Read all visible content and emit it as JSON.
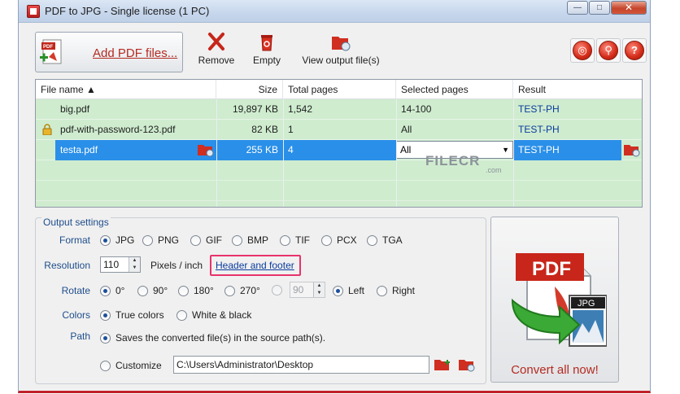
{
  "window": {
    "title": "PDF to JPG - Single license (1 PC)"
  },
  "toolbar": {
    "add_label": "Add PDF files...",
    "remove_label": "Remove",
    "empty_label": "Empty",
    "view_output_label": "View output file(s)",
    "help_label": "?"
  },
  "grid": {
    "headers": {
      "file_name": "File name ▲",
      "size": "Size",
      "total_pages": "Total pages",
      "selected_pages": "Selected pages",
      "result": "Result"
    },
    "rows": [
      {
        "file_name": "big.pdf",
        "size": "19,897 KB",
        "total_pages": "1,542",
        "selected_pages": "14-100",
        "result": "TEST-PH",
        "locked": false
      },
      {
        "file_name": "pdf-with-password-123.pdf",
        "size": "82 KB",
        "total_pages": "1",
        "selected_pages": "All",
        "result": "TEST-PH",
        "locked": true
      },
      {
        "file_name": "testa.pdf",
        "size": "255 KB",
        "total_pages": "4",
        "selected_pages": "All",
        "result": "TEST-PH",
        "locked": false,
        "selected": true
      }
    ]
  },
  "watermark": {
    "text": "FILECR",
    "sub": ".com"
  },
  "output": {
    "title": "Output settings",
    "format_label": "Format",
    "formats": [
      "JPG",
      "PNG",
      "GIF",
      "BMP",
      "TIF",
      "PCX",
      "TGA"
    ],
    "format_selected": "JPG",
    "resolution_label": "Resolution",
    "resolution_value": "110",
    "resolution_unit": "Pixels / inch",
    "header_footer_link": "Header and footer",
    "rotate_label": "Rotate",
    "rotations": [
      "0°",
      "90°",
      "180°",
      "270°"
    ],
    "rotation_selected": "0°",
    "custom_angle_value": "90",
    "rotate_left": "Left",
    "rotate_right": "Right",
    "colors_label": "Colors",
    "colors": [
      "True colors",
      "White & black"
    ],
    "colors_selected": "True colors",
    "path_label": "Path",
    "path_source_option": "Saves the converted file(s) in the source path(s).",
    "path_customize_option": "Customize",
    "path_value": "C:\\Users\\Administrator\\Desktop"
  },
  "convert": {
    "label": "Convert all now!",
    "pdf_text": "PDF",
    "jpg_text": "JPG"
  },
  "colors": {
    "accent_red": "#b52b22",
    "row_green": "#cfeccf",
    "selection_blue": "#2a8fe8",
    "link_blue": "#0a3b9e"
  }
}
